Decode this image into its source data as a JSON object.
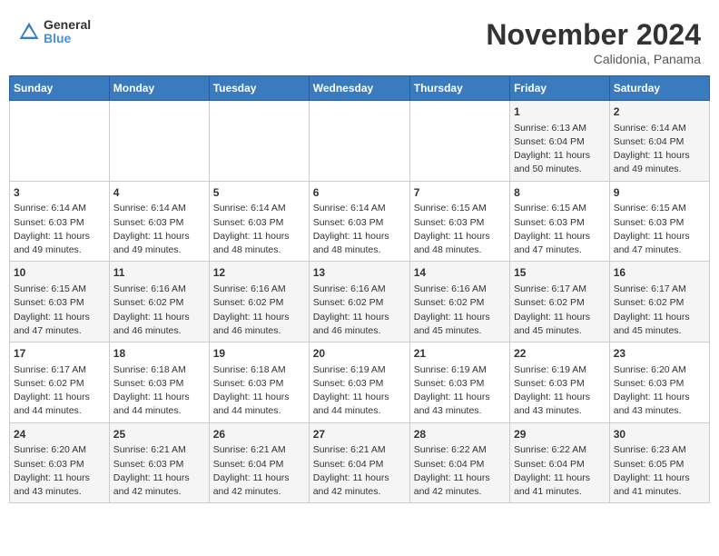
{
  "header": {
    "logo_line1": "General",
    "logo_line2": "Blue",
    "month": "November 2024",
    "location": "Calidonia, Panama"
  },
  "weekdays": [
    "Sunday",
    "Monday",
    "Tuesday",
    "Wednesday",
    "Thursday",
    "Friday",
    "Saturday"
  ],
  "rows": [
    [
      {
        "day": "",
        "info": ""
      },
      {
        "day": "",
        "info": ""
      },
      {
        "day": "",
        "info": ""
      },
      {
        "day": "",
        "info": ""
      },
      {
        "day": "",
        "info": ""
      },
      {
        "day": "1",
        "info": "Sunrise: 6:13 AM\nSunset: 6:04 PM\nDaylight: 11 hours\nand 50 minutes."
      },
      {
        "day": "2",
        "info": "Sunrise: 6:14 AM\nSunset: 6:04 PM\nDaylight: 11 hours\nand 49 minutes."
      }
    ],
    [
      {
        "day": "3",
        "info": "Sunrise: 6:14 AM\nSunset: 6:03 PM\nDaylight: 11 hours\nand 49 minutes."
      },
      {
        "day": "4",
        "info": "Sunrise: 6:14 AM\nSunset: 6:03 PM\nDaylight: 11 hours\nand 49 minutes."
      },
      {
        "day": "5",
        "info": "Sunrise: 6:14 AM\nSunset: 6:03 PM\nDaylight: 11 hours\nand 48 minutes."
      },
      {
        "day": "6",
        "info": "Sunrise: 6:14 AM\nSunset: 6:03 PM\nDaylight: 11 hours\nand 48 minutes."
      },
      {
        "day": "7",
        "info": "Sunrise: 6:15 AM\nSunset: 6:03 PM\nDaylight: 11 hours\nand 48 minutes."
      },
      {
        "day": "8",
        "info": "Sunrise: 6:15 AM\nSunset: 6:03 PM\nDaylight: 11 hours\nand 47 minutes."
      },
      {
        "day": "9",
        "info": "Sunrise: 6:15 AM\nSunset: 6:03 PM\nDaylight: 11 hours\nand 47 minutes."
      }
    ],
    [
      {
        "day": "10",
        "info": "Sunrise: 6:15 AM\nSunset: 6:03 PM\nDaylight: 11 hours\nand 47 minutes."
      },
      {
        "day": "11",
        "info": "Sunrise: 6:16 AM\nSunset: 6:02 PM\nDaylight: 11 hours\nand 46 minutes."
      },
      {
        "day": "12",
        "info": "Sunrise: 6:16 AM\nSunset: 6:02 PM\nDaylight: 11 hours\nand 46 minutes."
      },
      {
        "day": "13",
        "info": "Sunrise: 6:16 AM\nSunset: 6:02 PM\nDaylight: 11 hours\nand 46 minutes."
      },
      {
        "day": "14",
        "info": "Sunrise: 6:16 AM\nSunset: 6:02 PM\nDaylight: 11 hours\nand 45 minutes."
      },
      {
        "day": "15",
        "info": "Sunrise: 6:17 AM\nSunset: 6:02 PM\nDaylight: 11 hours\nand 45 minutes."
      },
      {
        "day": "16",
        "info": "Sunrise: 6:17 AM\nSunset: 6:02 PM\nDaylight: 11 hours\nand 45 minutes."
      }
    ],
    [
      {
        "day": "17",
        "info": "Sunrise: 6:17 AM\nSunset: 6:02 PM\nDaylight: 11 hours\nand 44 minutes."
      },
      {
        "day": "18",
        "info": "Sunrise: 6:18 AM\nSunset: 6:03 PM\nDaylight: 11 hours\nand 44 minutes."
      },
      {
        "day": "19",
        "info": "Sunrise: 6:18 AM\nSunset: 6:03 PM\nDaylight: 11 hours\nand 44 minutes."
      },
      {
        "day": "20",
        "info": "Sunrise: 6:19 AM\nSunset: 6:03 PM\nDaylight: 11 hours\nand 44 minutes."
      },
      {
        "day": "21",
        "info": "Sunrise: 6:19 AM\nSunset: 6:03 PM\nDaylight: 11 hours\nand 43 minutes."
      },
      {
        "day": "22",
        "info": "Sunrise: 6:19 AM\nSunset: 6:03 PM\nDaylight: 11 hours\nand 43 minutes."
      },
      {
        "day": "23",
        "info": "Sunrise: 6:20 AM\nSunset: 6:03 PM\nDaylight: 11 hours\nand 43 minutes."
      }
    ],
    [
      {
        "day": "24",
        "info": "Sunrise: 6:20 AM\nSunset: 6:03 PM\nDaylight: 11 hours\nand 43 minutes."
      },
      {
        "day": "25",
        "info": "Sunrise: 6:21 AM\nSunset: 6:03 PM\nDaylight: 11 hours\nand 42 minutes."
      },
      {
        "day": "26",
        "info": "Sunrise: 6:21 AM\nSunset: 6:04 PM\nDaylight: 11 hours\nand 42 minutes."
      },
      {
        "day": "27",
        "info": "Sunrise: 6:21 AM\nSunset: 6:04 PM\nDaylight: 11 hours\nand 42 minutes."
      },
      {
        "day": "28",
        "info": "Sunrise: 6:22 AM\nSunset: 6:04 PM\nDaylight: 11 hours\nand 42 minutes."
      },
      {
        "day": "29",
        "info": "Sunrise: 6:22 AM\nSunset: 6:04 PM\nDaylight: 11 hours\nand 41 minutes."
      },
      {
        "day": "30",
        "info": "Sunrise: 6:23 AM\nSunset: 6:05 PM\nDaylight: 11 hours\nand 41 minutes."
      }
    ]
  ]
}
